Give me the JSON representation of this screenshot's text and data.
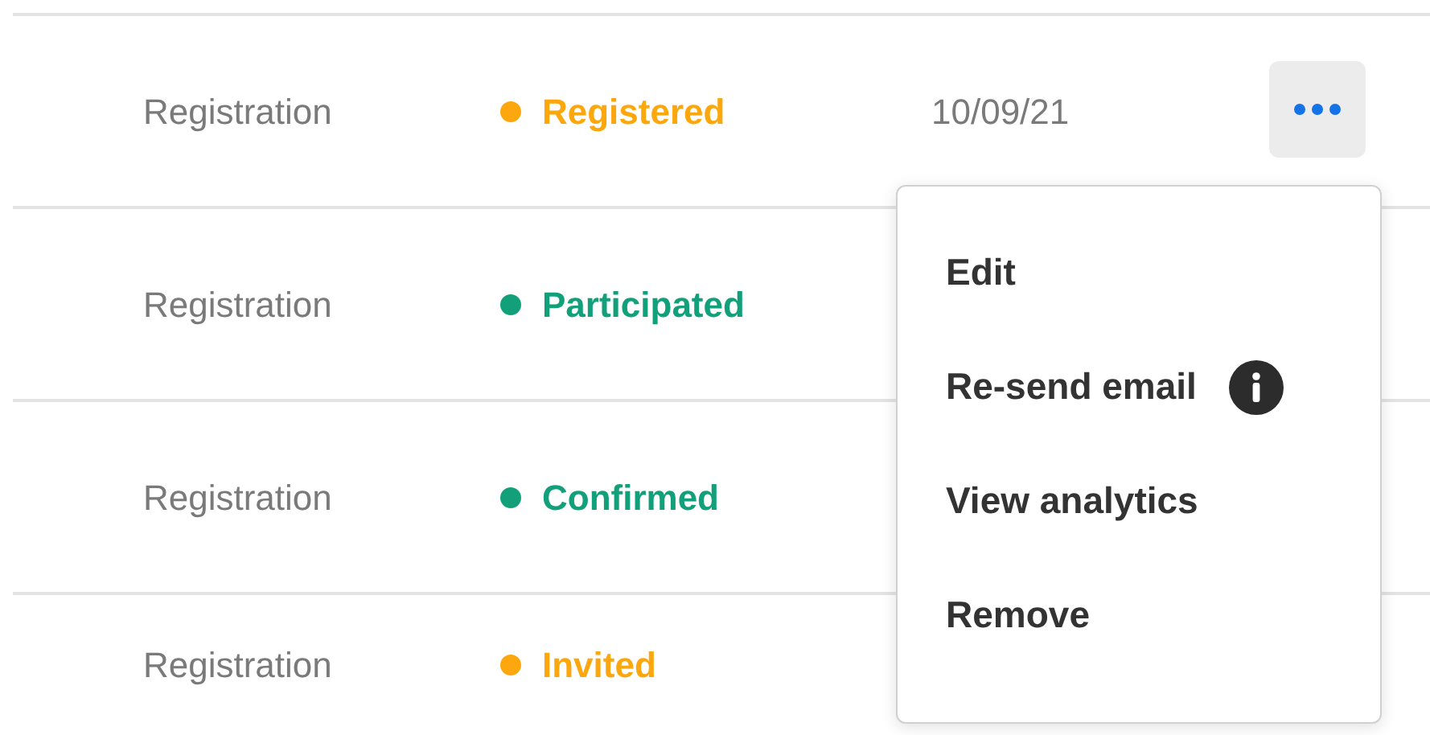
{
  "rows": [
    {
      "type": "Registration",
      "status": "Registered",
      "color": "#fca70d",
      "date": "10/09/21",
      "actions_button": true
    },
    {
      "type": "Registration",
      "status": "Participated",
      "color": "#12a07a"
    },
    {
      "type": "Registration",
      "status": "Confirmed",
      "color": "#12a07a"
    },
    {
      "type": "Registration",
      "status": "Invited",
      "color": "#fca70d"
    }
  ],
  "menu": {
    "items": [
      {
        "label": "Edit",
        "kind": "plain"
      },
      {
        "label": "Re-send email",
        "kind": "info"
      },
      {
        "label": "View analytics",
        "kind": "plain"
      },
      {
        "label": "Remove",
        "kind": "plain"
      }
    ]
  }
}
